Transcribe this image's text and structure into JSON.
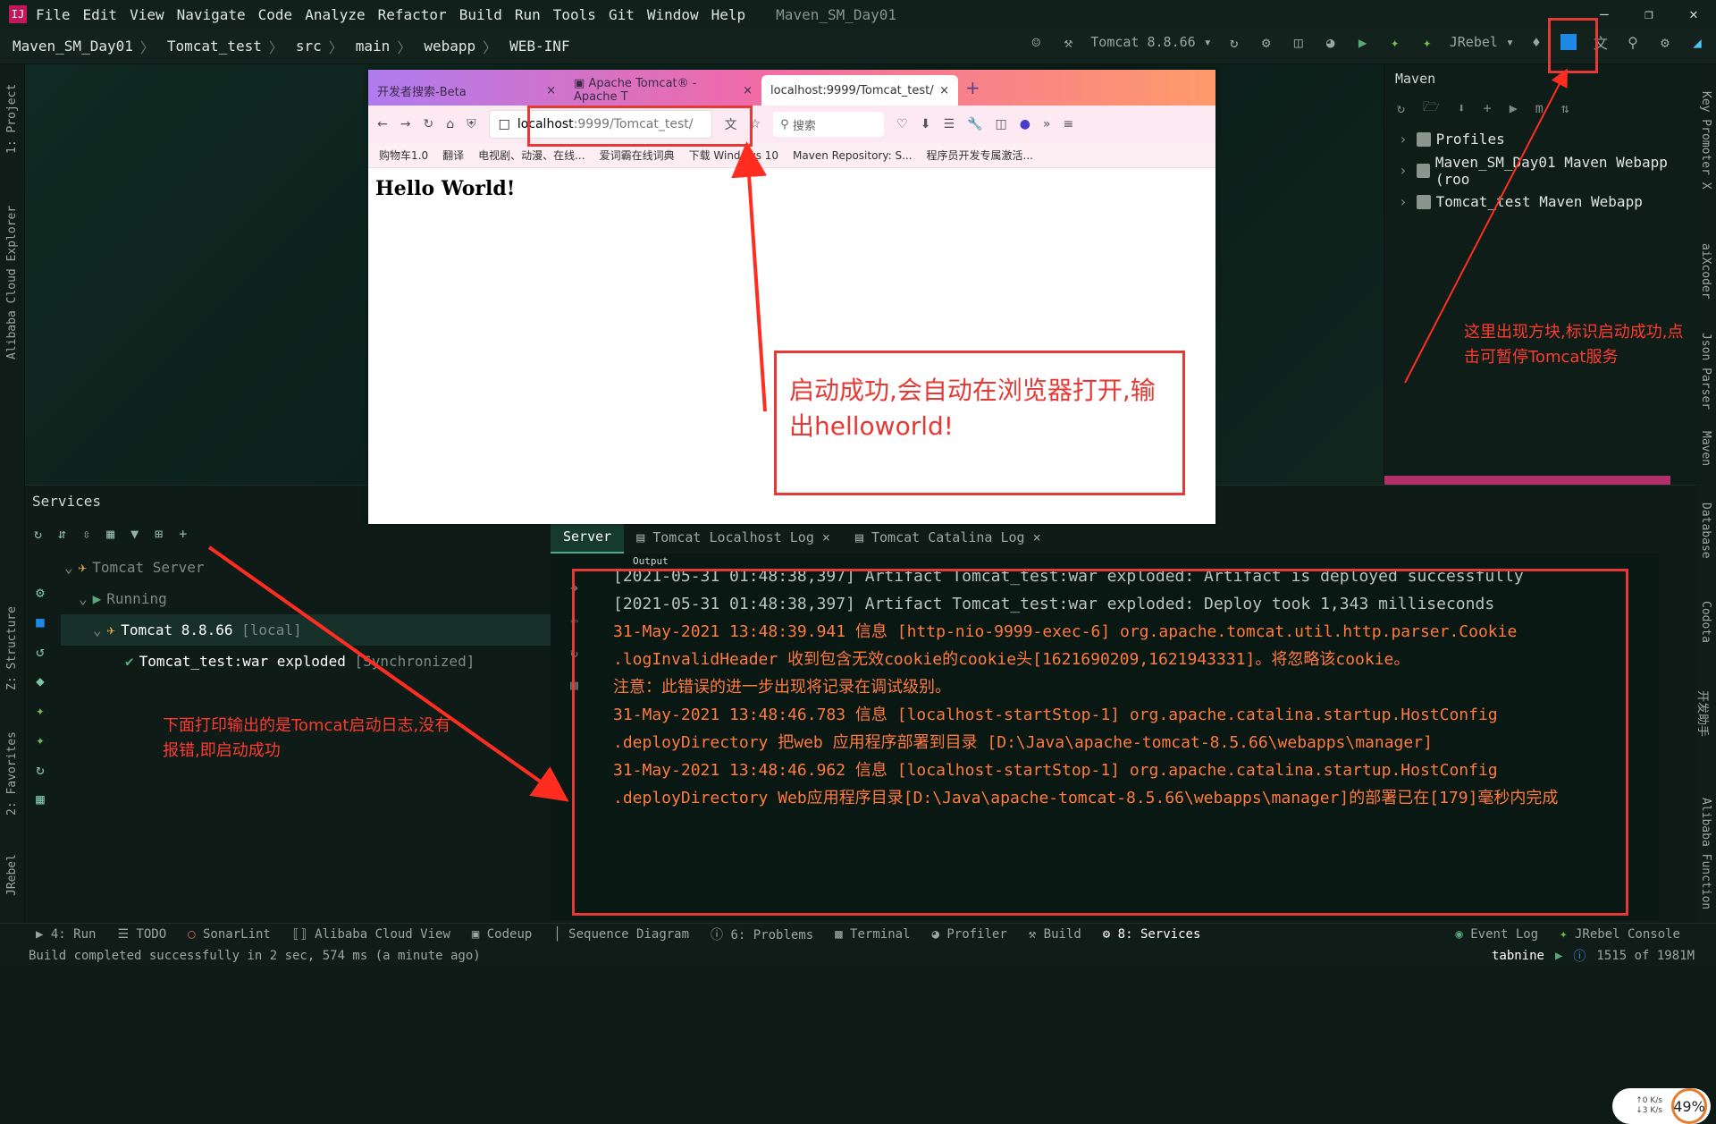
{
  "menu": {
    "items": [
      "File",
      "Edit",
      "View",
      "Navigate",
      "Code",
      "Analyze",
      "Refactor",
      "Build",
      "Run",
      "Tools",
      "Git",
      "Window",
      "Help"
    ],
    "window_title": "Maven_SM_Day01"
  },
  "breadcrumb": {
    "items": [
      "Maven_SM_Day01",
      "Tomcat_test",
      "src",
      "main",
      "webapp",
      "WEB-INF"
    ]
  },
  "toolbar": {
    "run_config": "Tomcat 8.8.66",
    "jrebel": "JRebel"
  },
  "left_strip": {
    "project": "1: Project",
    "cloud": "Alibaba Cloud Explorer",
    "structure": "Z: Structure",
    "favorites": "2: Favorites",
    "jrebel": "JRebel"
  },
  "right_strip": {
    "key_promoter": "Key Promoter X",
    "aixcoder": "aiXcoder",
    "json_parser": "Json Parser",
    "maven": "Maven",
    "database": "Database",
    "codota": "Codota",
    "kaifa": "开发助手",
    "alibaba": "Alibaba Function"
  },
  "maven": {
    "title": "Maven",
    "rows": [
      "Profiles",
      "Maven_SM_Day01 Maven Webapp (roo",
      "Tomcat_test Maven Webapp"
    ]
  },
  "browser": {
    "tabs": [
      "开发者搜索-Beta",
      "Apache Tomcat® - Apache T",
      "localhost:9999/Tomcat_test/"
    ],
    "url_host": "localhost",
    "url_rest": ":9999/Tomcat_test/",
    "search_placeholder": "搜索",
    "bookmarks": [
      "购物车1.0",
      "翻译",
      "电视剧、动漫、在线...",
      "爱词霸在线词典",
      "下载 Windows 10",
      "Maven Repository: S...",
      "程序员开发专属激活..."
    ],
    "content": "Hello World!"
  },
  "services": {
    "title": "Services",
    "tree": {
      "server": "Tomcat Server",
      "running": "Running",
      "instance": "Tomcat 8.8.66",
      "instance_tag": "[local]",
      "artifact": "Tomcat_test:war exploded",
      "artifact_tag": "[Synchronized]"
    },
    "tabs": [
      "Server",
      "Tomcat Localhost Log",
      "Tomcat Catalina Log"
    ],
    "output_label": "Output",
    "log": [
      {
        "text": "[2021-05-31 01:48:38,397] Artifact Tomcat_test:war exploded: Artifact is deployed successfully",
        "color": "gray"
      },
      {
        "text": "[2021-05-31 01:48:38,397] Artifact Tomcat_test:war exploded: Deploy took 1,343 milliseconds",
        "color": "gray"
      },
      {
        "text": "31-May-2021 13:48:39.941 信息 [http-nio-9999-exec-6] org.apache.tomcat.util.http.parser.Cookie",
        "color": "orange"
      },
      {
        "text": " .logInvalidHeader 收到包含无效cookie的cookie头[1621690209,1621943331]。将忽略该cookie。",
        "color": "orange"
      },
      {
        "text": " 注意：此错误的进一步出现将记录在调试级别。",
        "color": "orange"
      },
      {
        "text": "31-May-2021 13:48:46.783 信息 [localhost-startStop-1] org.apache.catalina.startup.HostConfig",
        "color": "orange"
      },
      {
        "text": " .deployDirectory 把web 应用程序部署到目录 [D:\\Java\\apache-tomcat-8.5.66\\webapps\\manager]",
        "color": "orange"
      },
      {
        "text": "31-May-2021 13:48:46.962 信息 [localhost-startStop-1] org.apache.catalina.startup.HostConfig",
        "color": "orange"
      },
      {
        "text": " .deployDirectory Web应用程序目录[D:\\Java\\apache-tomcat-8.5.66\\webapps\\manager]的部署已在[179]毫秒内完成",
        "color": "orange"
      }
    ]
  },
  "perf_widget": {
    "up": "0 K/s",
    "down": "3 K/s",
    "percent": "49%"
  },
  "annotations": {
    "browser_note": "启动成功,会自动在浏览器打开,输出helloworld!",
    "stop_note": "这里出现方块,标识启动成功,点击可暂停Tomcat服务",
    "log_note": "下面打印输出的是Tomcat启动日志,没有报错,即启动成功"
  },
  "statusbar": {
    "tools": [
      "4: Run",
      "TODO",
      "SonarLint",
      "Alibaba Cloud View",
      "Codeup",
      "Sequence Diagram",
      "6: Problems",
      "Terminal",
      "Profiler",
      "Build",
      "8: Services"
    ],
    "right_tools": [
      "Event Log",
      "JRebel Console"
    ],
    "message": "Build completed successfully in 2 sec, 574 ms (a minute ago)",
    "tabnine": "tabnine",
    "memory": "1515 of 1981M"
  },
  "colors": {
    "accent_red": "#e53935",
    "log_orange": "#ff7a3d",
    "log_gray": "#b8c2be",
    "stop_blue": "#1e88e5"
  }
}
